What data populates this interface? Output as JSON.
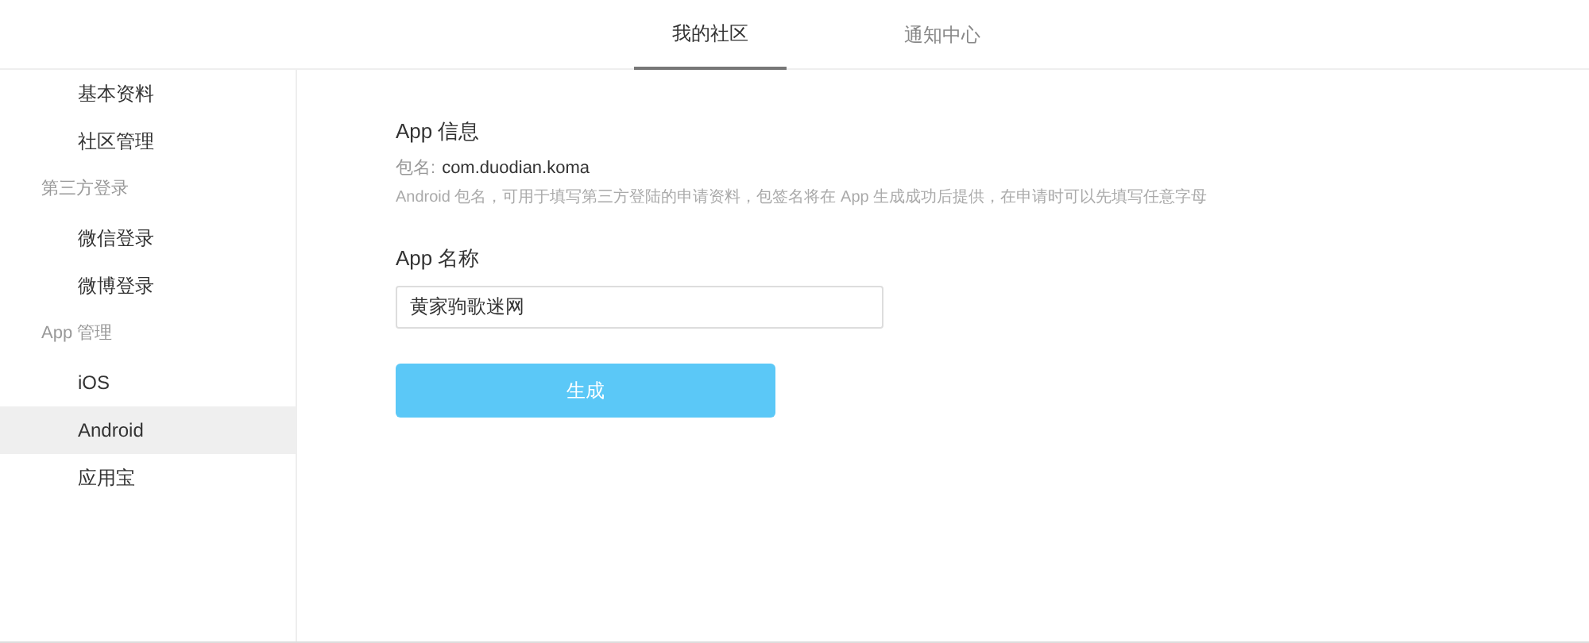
{
  "tabs": [
    {
      "label": "我的社区",
      "selected": true
    },
    {
      "label": "通知中心",
      "selected": false
    }
  ],
  "sidebar": {
    "items": [
      {
        "kind": "link",
        "label": "基本资料",
        "selected": false
      },
      {
        "kind": "link",
        "label": "社区管理",
        "selected": false
      },
      {
        "kind": "header",
        "label": "第三方登录"
      },
      {
        "kind": "link",
        "label": "微信登录",
        "selected": false
      },
      {
        "kind": "link",
        "label": "微博登录",
        "selected": false
      },
      {
        "kind": "header",
        "label": "App 管理"
      },
      {
        "kind": "link",
        "label": "iOS",
        "selected": false
      },
      {
        "kind": "link",
        "label": "Android",
        "selected": true
      },
      {
        "kind": "link",
        "label": "应用宝",
        "selected": false
      }
    ]
  },
  "app_info": {
    "title": "App 信息",
    "package_label": "包名:",
    "package_value": "com.duodian.koma",
    "hint": "Android 包名，可用于填写第三方登陆的申请资料，包签名将在 App 生成成功后提供，在申请时可以先填写任意字母"
  },
  "app_name": {
    "label": "App 名称",
    "value": "黄家驹歌迷网"
  },
  "button": "生成"
}
